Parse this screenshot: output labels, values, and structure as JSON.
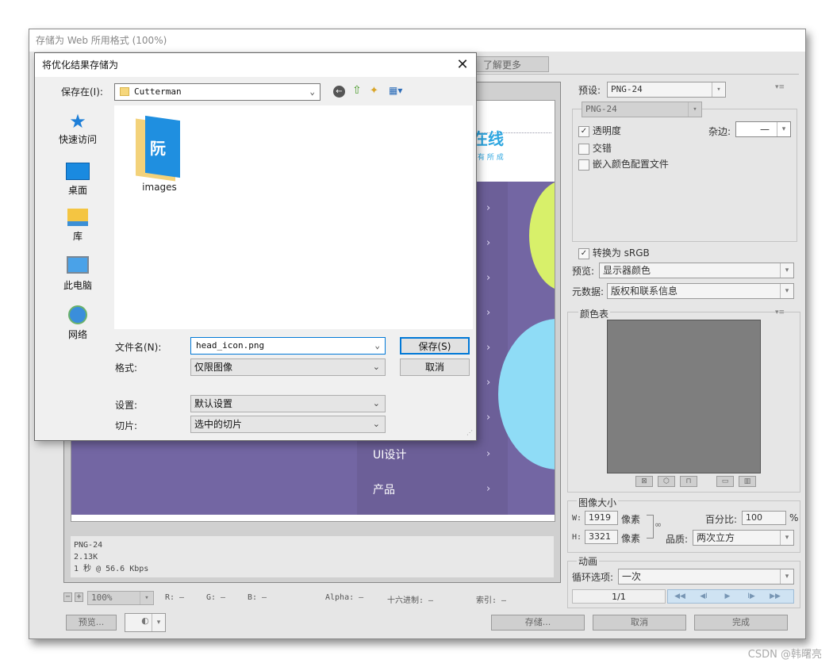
{
  "window": {
    "title": "存储为 Web 所用格式 (100%)"
  },
  "tabs": {
    "learn_more": "了解更多"
  },
  "preview": {
    "logo_text": "在线",
    "logo_sub": "有 所 成",
    "menu_items": [
      "UI设计",
      "产品"
    ],
    "info_format": "PNG-24",
    "info_size": "2.13K",
    "info_speed": "1 秒 @ 56.6 Kbps"
  },
  "status": {
    "zoom": "100%",
    "r": "R: —",
    "g": "G: —",
    "b": "B: —",
    "alpha": "Alpha: —",
    "hex": "十六进制: —",
    "index": "索引: —"
  },
  "bottom_buttons": {
    "preview": "预览...",
    "store": "存储...",
    "cancel": "取消",
    "done": "完成"
  },
  "right_panel": {
    "preset_label": "预设:",
    "preset_value": "PNG-24",
    "format_value": "PNG-24",
    "transparency": "透明度",
    "matte_label": "杂边:",
    "matte_value": "—",
    "interlaced": "交错",
    "embed_profile": "嵌入颜色配置文件",
    "convert_srgb": "转换为 sRGB",
    "preview_label": "预览:",
    "preview_value": "显示器颜色",
    "metadata_label": "元数据:",
    "metadata_value": "版权和联系信息",
    "color_table": "颜色表",
    "image_size": "图像大小",
    "w_label": "W:",
    "w_value": "1919",
    "h_label": "H:",
    "h_value": "3321",
    "pixels": "像素",
    "percent_label": "百分比:",
    "percent_value": "100",
    "percent_unit": "%",
    "quality_label": "品质:",
    "quality_value": "两次立方",
    "animation": "动画",
    "loop_label": "循环选项:",
    "loop_value": "一次",
    "frame": "1/1"
  },
  "dialog": {
    "title": "将优化结果存储为",
    "save_in_label": "保存在(I):",
    "save_in_value": "Cutterman",
    "nav": [
      "快速访问",
      "桌面",
      "库",
      "此电脑",
      "网络"
    ],
    "folder_name": "images",
    "filename_label": "文件名(N):",
    "filename_value": "head_icon.png",
    "format_label": "格式:",
    "format_value": "仅限图像",
    "settings_label": "设置:",
    "settings_value": "默认设置",
    "slices_label": "切片:",
    "slices_value": "选中的切片",
    "save_button": "保存(S)",
    "cancel_button": "取消"
  },
  "watermark": "CSDN @韩曙亮",
  "colors": {
    "accent_purple": "#7366a3",
    "menu_purple": "#6c5f98",
    "circle_green": "#d8f06a",
    "circle_blue": "#8fdcf6",
    "focus_blue": "#0078d7"
  }
}
